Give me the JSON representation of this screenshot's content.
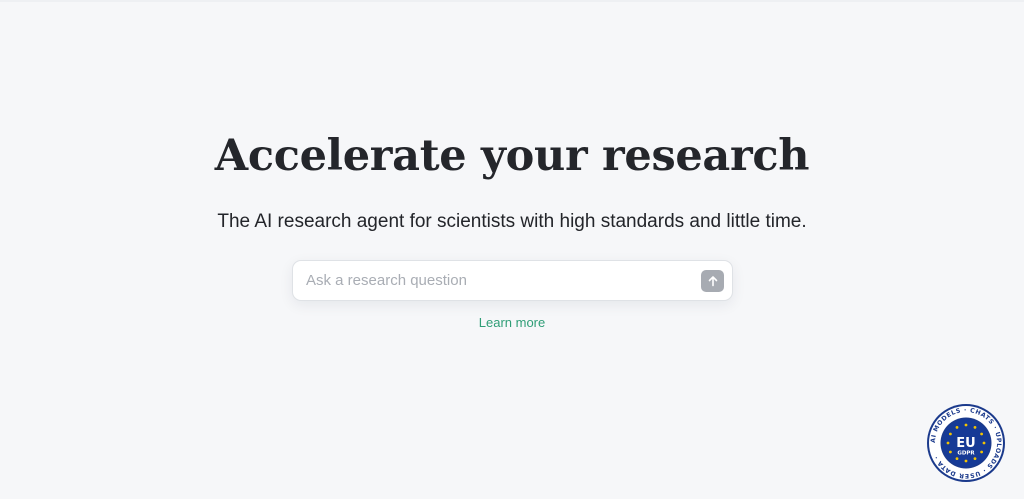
{
  "hero": {
    "headline": "Accelerate your research",
    "subheadline": "The AI research agent for scientists with high standards and little time."
  },
  "search": {
    "placeholder": "Ask a research question",
    "value": "",
    "submit_icon": "arrow-up-icon"
  },
  "learn_more_label": "Learn more",
  "badge": {
    "center_label": "EU",
    "sub_label": "GDPR",
    "ring_text": "AI MODELS · CHATS · UPLOADS · USER DATA ·",
    "colors": {
      "ring": "#ffffff",
      "border": "#1b3a8c",
      "center": "#163a96",
      "stars": "#f3c400"
    }
  },
  "colors": {
    "background": "#f6f7f9",
    "accent_link": "#2f9e77",
    "submit_button": "#a7abb2"
  }
}
